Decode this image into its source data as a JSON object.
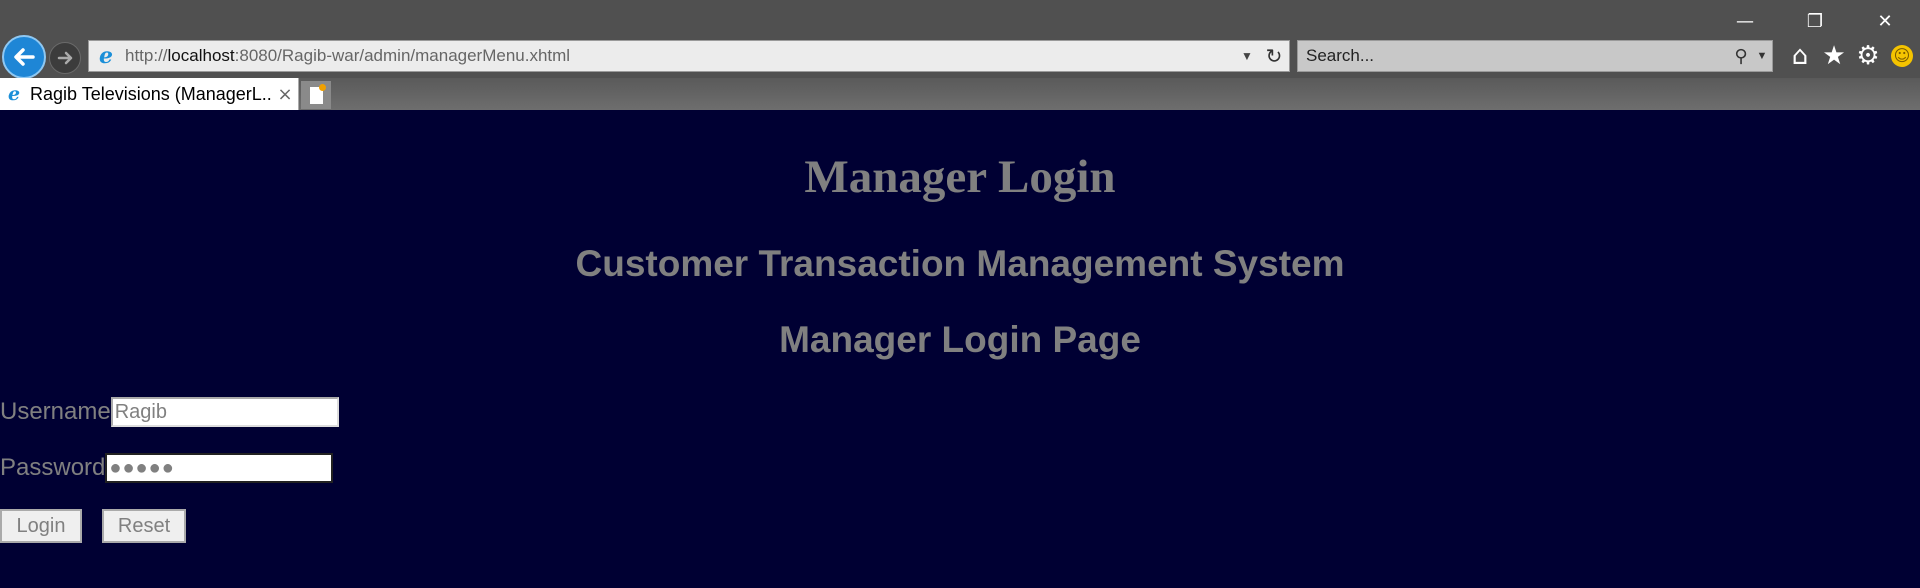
{
  "browser": {
    "address": {
      "url_prefix": "http://",
      "url_host": "localhost",
      "url_rest": ":8080/Ragib-war/admin/managerMenu.xhtml"
    },
    "search": {
      "placeholder": "Search..."
    },
    "tab": {
      "title": "Ragib Televisions (ManagerL...",
      "close": "×"
    },
    "controls": {
      "minimize": "—",
      "restore": "❐",
      "close": "✕"
    },
    "icons": {
      "back": "back-arrow-icon",
      "forward": "forward-arrow-icon",
      "refresh": "refresh-icon",
      "search": "search-icon",
      "home": "home-icon",
      "favorites": "star-icon",
      "settings": "gear-icon",
      "feedback": "smiley-icon"
    }
  },
  "page": {
    "heading": "Manager Login",
    "subheading": "Customer Transaction Management System",
    "page_title": "Manager Login Page",
    "form": {
      "username_label": "Username",
      "username_value": "Ragib",
      "password_label": "Password",
      "password_value": "●●●●●",
      "login_label": "Login",
      "reset_label": "Reset"
    }
  },
  "colors": {
    "page_background": "#000033",
    "page_text": "#808080",
    "chrome_background": "#505050",
    "back_button": "#1e86d6"
  }
}
